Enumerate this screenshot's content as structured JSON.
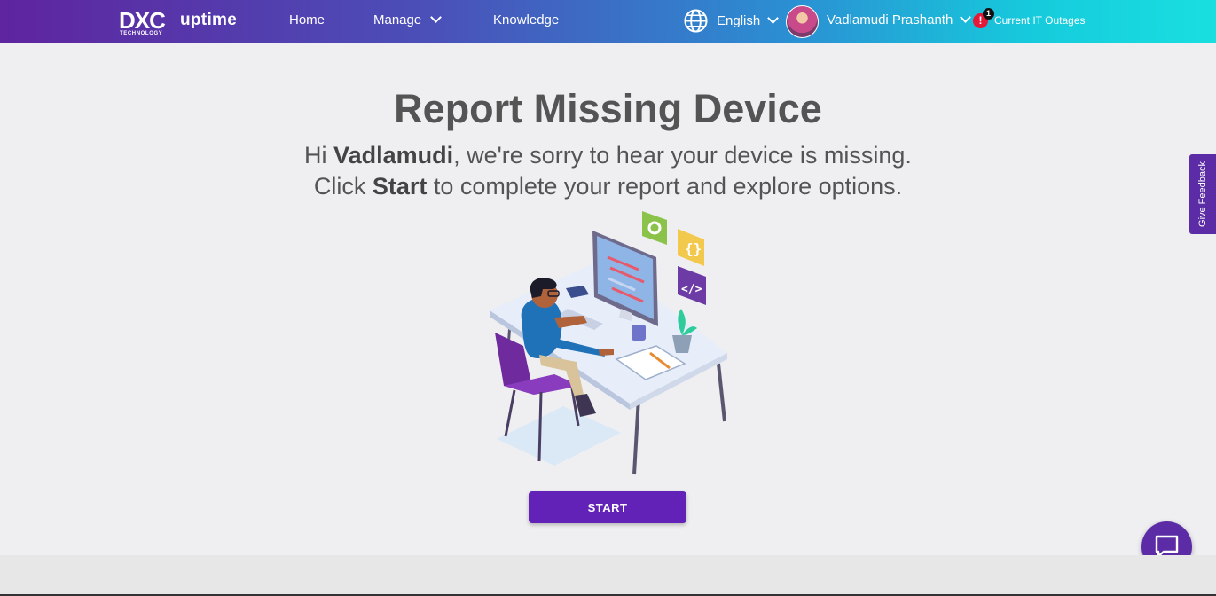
{
  "header": {
    "logo_dxc": "DXC",
    "logo_tech": "TECHNOLOGY",
    "logo_product": "uptime",
    "nav": [
      {
        "label": "Home"
      },
      {
        "label": "Manage"
      },
      {
        "label": "Knowledge"
      }
    ],
    "language": "English",
    "user_name": "Vadlamudi Prashanth",
    "alert_count": "1",
    "alert_symbol": "!",
    "outages_label": "Current IT Outages"
  },
  "main": {
    "title": "Report Missing Device",
    "line1_pre": "Hi ",
    "line1_name": "Vadlamudi",
    "line1_post": ", we're sorry to hear your device is missing.",
    "line2_pre": "Click ",
    "line2_bold": "Start",
    "line2_post": " to complete your report and explore options.",
    "start_label": "START"
  },
  "feedback_label": "Give Feedback",
  "colors": {
    "brand_purple": "#5f249f",
    "button_purple": "#6222b8",
    "alert_red": "#e31937",
    "header_gradient_end": "#19dfe0"
  },
  "icons": {
    "globe": "globe-icon",
    "chat": "chat-bubble-icon",
    "alert": "alert-icon",
    "chevron": "chevron-down-icon"
  }
}
